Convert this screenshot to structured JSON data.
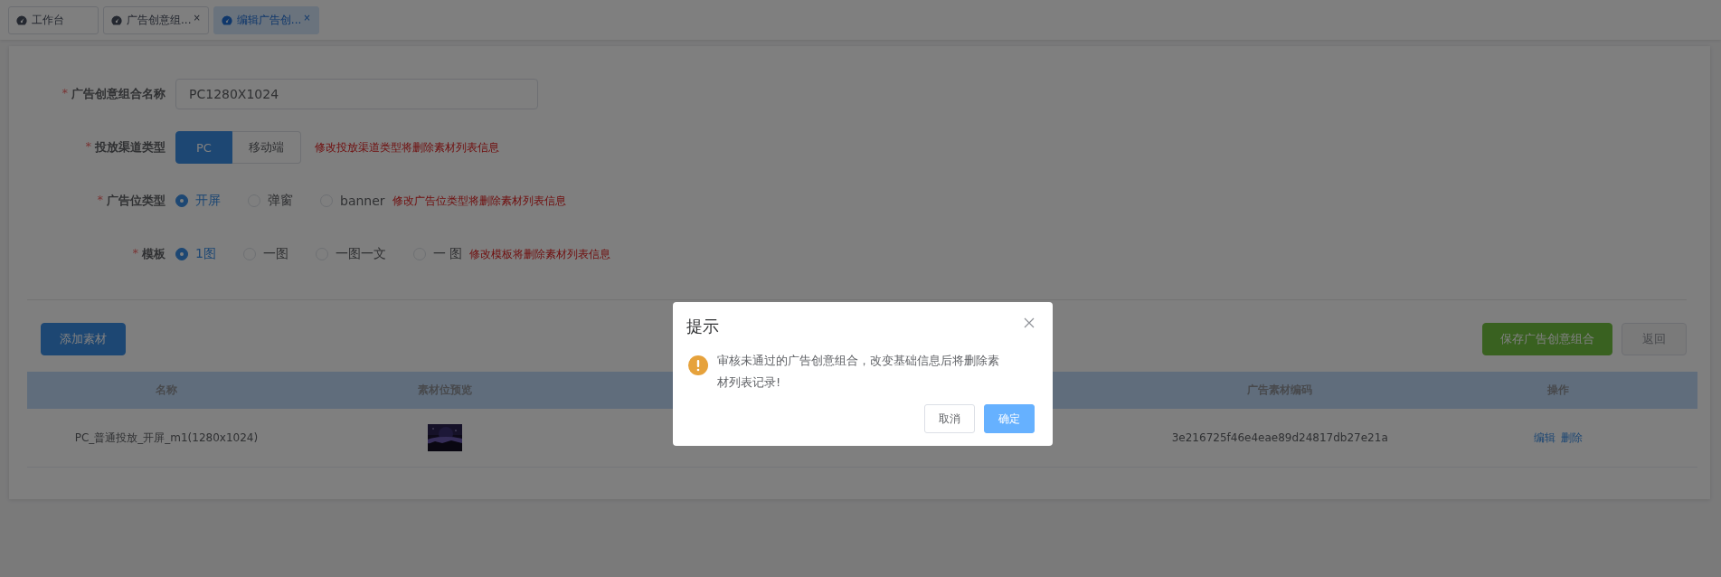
{
  "tabs": [
    {
      "label": "工作台",
      "selected": false
    },
    {
      "label": "广告创意组...",
      "selected": false,
      "close": "×"
    },
    {
      "label": "编辑广告创...",
      "selected": true,
      "close": "×"
    }
  ],
  "form": {
    "name_field": {
      "mark": "*",
      "label": "广告创意组合名称",
      "value": "PC1280X1024"
    },
    "channel": {
      "mark": "*",
      "label": "投放渠道类型",
      "options": [
        {
          "label": "PC",
          "selected": true
        },
        {
          "label": "移动端",
          "selected": false
        }
      ],
      "hint": "修改投放渠道类型将删除素材列表信息"
    },
    "ad_position": {
      "mark": "*",
      "label": "广告位类型",
      "options": [
        {
          "label": "开屏",
          "selected": true
        },
        {
          "label": "弹窗",
          "selected": false
        },
        {
          "label": "banner",
          "selected": false
        }
      ],
      "hint": "修改广告位类型将删除素材列表信息"
    },
    "template": {
      "mark": "*",
      "label": "模板",
      "options": [
        {
          "label": "1图",
          "selected": true
        },
        {
          "label": "一图",
          "selected": false
        },
        {
          "label": "一图一文",
          "selected": false
        },
        {
          "label": "一 图",
          "selected": false
        }
      ],
      "hint": "修改模板将删除素材列表信息"
    }
  },
  "toolbar": {
    "add_button": "添加素材",
    "save_button": "保存广告创意组合",
    "back_button": "返回"
  },
  "table": {
    "columns": [
      {
        "label": "名称"
      },
      {
        "label": "素材位预览"
      },
      {},
      {},
      {
        "label": "广告素材编码"
      },
      {
        "label": "操作"
      }
    ],
    "rows": [
      {
        "name": "PC_普通投放_开屏_m1(1280x1024)",
        "preview": {
          "kind": "picture"
        },
        "code": "3e216725f46e4eae89d24817db27e21a",
        "actions": [
          "编辑",
          "删除"
        ]
      }
    ]
  },
  "dialog": {
    "title": "提示",
    "message": "审核未通过的广告创意组合，改变基础信息后将删除素材列表记录!",
    "buttons": [
      {
        "label": "取消",
        "kind": "default"
      },
      {
        "label": "确定",
        "kind": "primary"
      }
    ]
  }
}
